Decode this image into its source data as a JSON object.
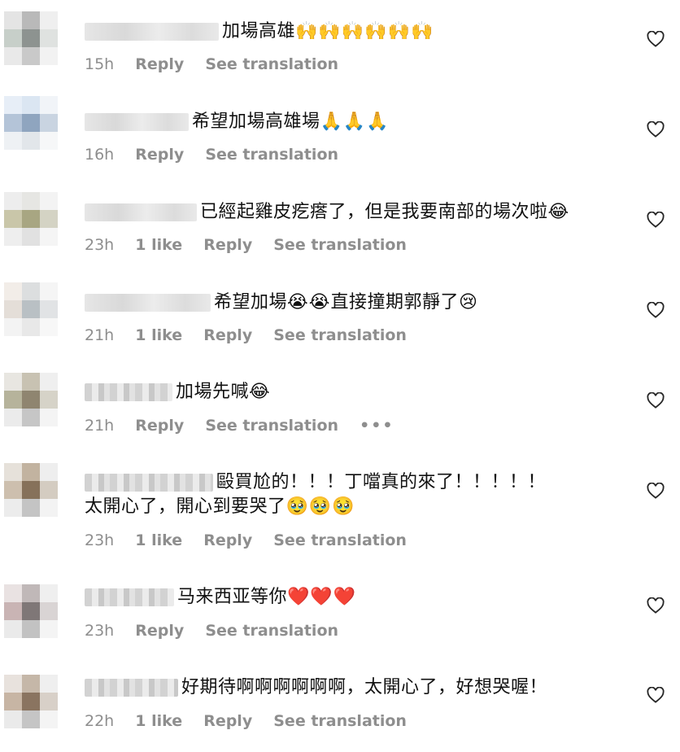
{
  "colors": {
    "meta_text": "#8e8e8e",
    "body_text": "#111111"
  },
  "comments": [
    {
      "text": "加場高雄",
      "emoji": "🙌🙌🙌🙌🙌🙌",
      "time": "15h",
      "likes": "",
      "reply": "Reply",
      "translate": "See translation"
    },
    {
      "text": "希望加場高雄場",
      "emoji": "🙏🙏🙏",
      "time": "16h",
      "likes": "",
      "reply": "Reply",
      "translate": "See translation"
    },
    {
      "text": "已經起雞皮疙瘩了，但是我要南部的場次啦",
      "emoji": "😂",
      "time": "23h",
      "likes": "1 like",
      "reply": "Reply",
      "translate": "See translation"
    },
    {
      "text_a": "希望加場",
      "emoji_a": "😭😭",
      "text_b": "直接撞期郭靜了",
      "emoji_b": "😢",
      "time": "21h",
      "likes": "1 like",
      "reply": "Reply",
      "translate": "See translation"
    },
    {
      "text": "加場先喊",
      "emoji": "😂",
      "time": "21h",
      "likes": "",
      "reply": "Reply",
      "translate": "See translation",
      "more": "•••"
    },
    {
      "text": "毆買尬的！！！丁噹真的來了！！！！！",
      "text2": "太開心了，開心到要哭了",
      "emoji2": "🥹🥹🥹",
      "time": "23h",
      "likes": "1 like",
      "reply": "Reply",
      "translate": "See translation"
    },
    {
      "text": "马来西亚等你",
      "emoji": "❤️❤️❤️",
      "time": "23h",
      "likes": "",
      "reply": "Reply",
      "translate": "See translation"
    },
    {
      "text": "好期待啊啊啊啊啊啊，太開心了，好想哭喔！",
      "time": "22h",
      "likes": "1 like",
      "reply": "Reply",
      "translate": "See translation"
    }
  ],
  "icons": {
    "like": "heart-outline-icon",
    "more": "more-horizontal-icon"
  }
}
